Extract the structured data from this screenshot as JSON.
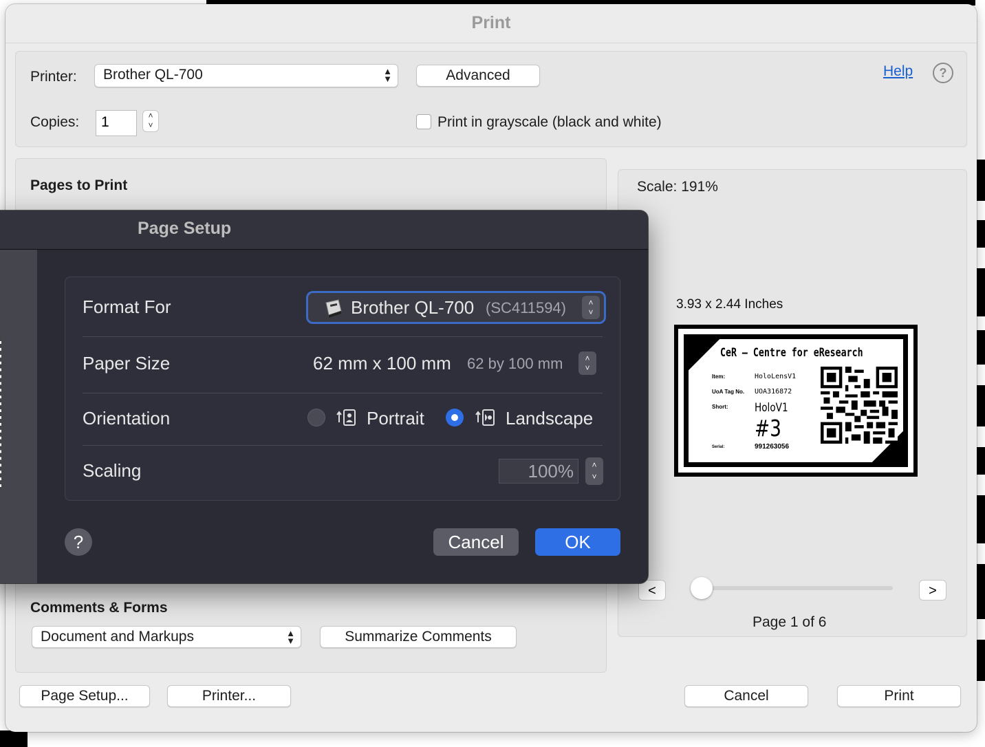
{
  "print_dialog": {
    "title": "Print",
    "printer_label": "Printer:",
    "printer_value": "Brother QL-700",
    "advanced_label": "Advanced",
    "help_link": "Help",
    "copies_label": "Copies:",
    "copies_value": "1",
    "grayscale_label": "Print in grayscale (black and white)",
    "grayscale_checked": false,
    "pages_to_print_heading": "Pages to Print",
    "scale_text": "Scale: 191%",
    "preview_size": "3.93 x 2.44 Inches",
    "page_indicator": "Page 1 of 6",
    "prev_label": "<",
    "next_label": ">",
    "page_slider_value": 1,
    "comments_heading": "Comments & Forms",
    "comments_value": "Document and Markups",
    "summarize_label": "Summarize Comments",
    "page_setup_label": "Page Setup...",
    "printer_button_label": "Printer...",
    "cancel_label": "Cancel",
    "print_label": "Print"
  },
  "preview_label_content": {
    "header": "CeR – Centre for eResearch",
    "item_key": "Item:",
    "item_value": "HoloLensV1",
    "tag_key": "UoA Tag No.",
    "tag_value": "UOA316872",
    "short_key": "Short:",
    "short_value": "HoloV1",
    "number": "#3",
    "serial_key": "Serial:",
    "serial_value": "991263056"
  },
  "page_setup": {
    "title": "Page Setup",
    "format_for_label": "Format For",
    "format_for_value": "Brother QL-700",
    "format_for_id": "(SC411594)",
    "paper_size_label": "Paper Size",
    "paper_size_value": "62 mm x 100 mm",
    "paper_size_detail": "62 by 100 mm",
    "orientation_label": "Orientation",
    "portrait_label": "Portrait",
    "landscape_label": "Landscape",
    "orientation_selected": "Landscape",
    "scaling_label": "Scaling",
    "scaling_value": "100%",
    "help_symbol": "?",
    "cancel_label": "Cancel",
    "ok_label": "OK"
  },
  "colors": {
    "accent": "#2e6fe6",
    "sheet_background": "#2b2b36",
    "dialog_background": "#ececec",
    "link": "#1a5fd0"
  }
}
